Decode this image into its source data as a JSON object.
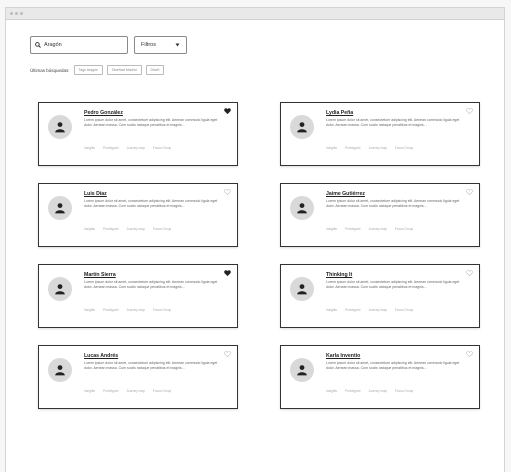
{
  "search": {
    "value": "Aragón"
  },
  "filter": {
    "value": "Filtros"
  },
  "recent": {
    "label": "Últimas búsquedas:",
    "chips": [
      "Tags Aragón",
      "Diseñad Madrid",
      "Diseñ"
    ]
  },
  "cards": [
    {
      "name": "Pedro González",
      "liked": true,
      "desc": "Lorem ipsum dolor sit amet, consectetuer adipiscing elit. Aenean commodo ligula eget dolor. Aenean massa. Cum sociis natoque penatibus et magnis...",
      "tags": [
        "Insights",
        "Prototyped",
        "Journey map",
        "Focus Group"
      ]
    },
    {
      "name": "Lydia Peña",
      "liked": false,
      "desc": "Lorem ipsum dolor sit amet, consectetuer adipiscing elit. Aenean commodo ligula eget dolor. Aenean massa. Cum sociis natoque penatibus et magnis...",
      "tags": [
        "Insights",
        "Prototyped",
        "Journey map",
        "Focus Group"
      ]
    },
    {
      "name": "Luis Díaz",
      "liked": false,
      "desc": "Lorem ipsum dolor sit amet, consectetuer adipiscing elit. Aenean commodo ligula eget dolor. Aenean massa. Cum sociis natoque penatibus et magnis...",
      "tags": [
        "Insights",
        "Prototyped",
        "Journey map",
        "Focus Group"
      ]
    },
    {
      "name": "Jaime Gutiérrez",
      "liked": false,
      "desc": "Lorem ipsum dolor sit amet, consectetuer adipiscing elit. Aenean commodo ligula eget dolor. Aenean massa. Cum sociis natoque penatibus et magnis...",
      "tags": [
        "Insights",
        "Prototyped",
        "Journey map",
        "Focus Group"
      ]
    },
    {
      "name": "Martín Sierra",
      "liked": true,
      "desc": "Lorem ipsum dolor sit amet, consectetuer adipiscing elit. Aenean commodo ligula eget dolor. Aenean massa. Cum sociis natoque penatibus et magnis...",
      "tags": [
        "Insights",
        "Prototyped",
        "Journey map",
        "Focus Group"
      ]
    },
    {
      "name": "Thinking It",
      "liked": false,
      "desc": "Lorem ipsum dolor sit amet, consectetuer adipiscing elit. Aenean commodo ligula eget dolor. Aenean massa. Cum sociis natoque penatibus et magnis...",
      "tags": [
        "Insights",
        "Prototyped",
        "Journey map",
        "Focus Group"
      ]
    },
    {
      "name": "Lucas Andrés",
      "liked": false,
      "desc": "Lorem ipsum dolor sit amet, consectetuer adipiscing elit. Aenean commodo ligula eget dolor. Aenean massa. Cum sociis natoque penatibus et magnis...",
      "tags": [
        "Insights",
        "Prototyped",
        "Journey map",
        "Focus Group"
      ]
    },
    {
      "name": "Karla Inventio",
      "liked": false,
      "desc": "Lorem ipsum dolor sit amet, consectetuer adipiscing elit. Aenean commodo ligula eget dolor. Aenean massa. Cum sociis natoque penatibus et magnis...",
      "tags": [
        "Insights",
        "Prototyped",
        "Journey map",
        "Focus Group"
      ]
    }
  ],
  "icons": {
    "search": "search-icon",
    "dropdown": "chevron-down-icon",
    "avatar": "person-icon",
    "heart": "heart-icon"
  },
  "colors": {
    "heart_filled": "#222222",
    "heart_empty": "#bbbbbb",
    "card_border": "#333333",
    "avatar_bg": "#d9d9d9"
  }
}
